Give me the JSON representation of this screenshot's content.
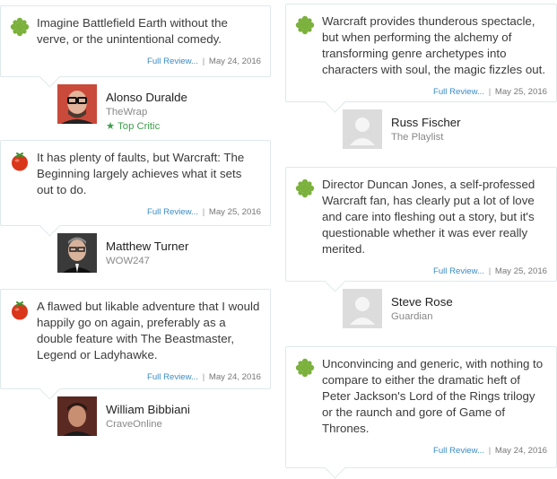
{
  "left_reviews": [
    {
      "icon": "rotten-splat-icon",
      "quote": "Imagine Battlefield Earth without the verve, or the unintentional comedy.",
      "link_label": "Full Review...",
      "separator": "|",
      "date": "May 24, 2016",
      "critic": {
        "name": "Alonso Duralde",
        "publication": "TheWrap",
        "top_critic_label": "Top Critic",
        "avatar": "photo"
      }
    },
    {
      "icon": "fresh-tomato-icon",
      "quote": "It has plenty of faults, but Warcraft: The Beginning largely achieves what it sets out to do.",
      "link_label": "Full Review...",
      "separator": "|",
      "date": "May 25, 2016",
      "critic": {
        "name": "Matthew Turner",
        "publication": "WOW247",
        "avatar": "photo"
      }
    },
    {
      "icon": "fresh-tomato-icon",
      "quote": "A flawed but likable adventure that I would happily go on again, preferably as a double feature with The Beastmaster, Legend or Ladyhawke.",
      "link_label": "Full Review...",
      "separator": "|",
      "date": "May 24, 2016",
      "critic": {
        "name": "William Bibbiani",
        "publication": "CraveOnline",
        "avatar": "photo"
      }
    }
  ],
  "right_reviews": [
    {
      "icon": "rotten-splat-icon",
      "quote": "Warcraft provides thunderous spectacle, but when performing the alchemy of transforming genre archetypes into characters with soul, the magic fizzles out.",
      "link_label": "Full Review...",
      "separator": "|",
      "date": "May 25, 2016",
      "critic": {
        "name": "Russ Fischer",
        "publication": "The Playlist",
        "avatar": "placeholder"
      }
    },
    {
      "icon": "rotten-splat-icon",
      "quote": "Director Duncan Jones, a self-professed Warcraft fan, has clearly put a lot of love and care into fleshing out a story, but it's questionable whether it was ever really merited.",
      "link_label": "Full Review...",
      "separator": "|",
      "date": "May 25, 2016",
      "critic": {
        "name": "Steve Rose",
        "publication": "Guardian",
        "avatar": "placeholder"
      }
    },
    {
      "icon": "rotten-splat-icon",
      "quote": "Unconvincing and generic, with nothing to compare to either the dramatic heft of Peter Jackson's Lord of the Rings trilogy or the raunch and gore of Game of Thrones.",
      "link_label": "Full Review...",
      "separator": "|",
      "date": "May 24, 2016",
      "critic": {
        "name": "",
        "publication": "",
        "avatar": "none"
      }
    }
  ],
  "colors": {
    "fresh": "#d9361c",
    "rotten": "#7bb13c",
    "link": "#3a8cc4",
    "top_critic": "#3f9e4d"
  }
}
